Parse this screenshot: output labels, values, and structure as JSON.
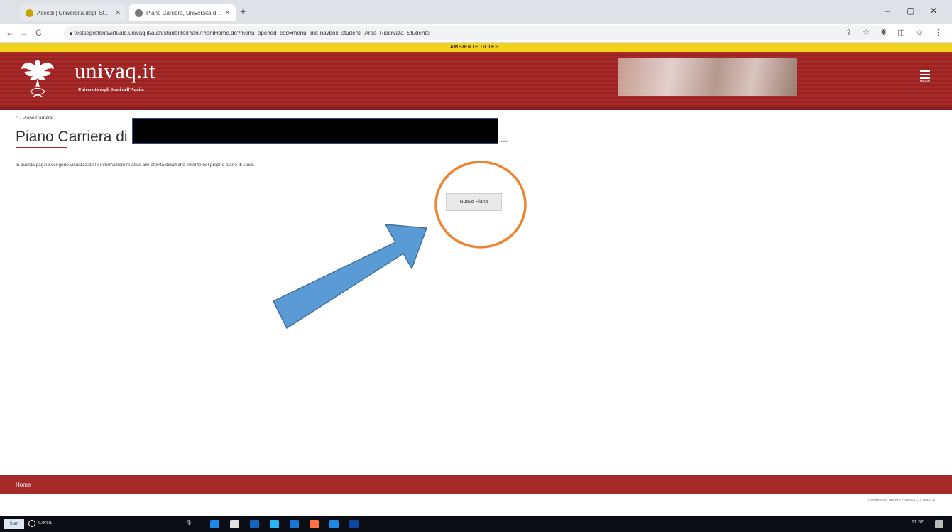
{
  "browser": {
    "tabs": [
      {
        "title": "Accedi | Università degli Studi de...",
        "active": false
      },
      {
        "title": "Piano Carriera, Università di Ul...",
        "active": true
      }
    ],
    "new_tab": "+",
    "window_controls": {
      "minimize": "–",
      "maximize": "▢",
      "close": "✕"
    },
    "nav": {
      "back": "←",
      "forward": "→",
      "reload": "C"
    },
    "url": "testsegreteriavirtuale.univaq.it/auth/studente/Piani/PianiHome.do?menu_opened_cod=menu_link-navbox_studenti_Area_Riservata_Studente",
    "toolbar_icons": "⇪ ☆ ✱ ◫ ☺ ⋮"
  },
  "site": {
    "test_banner": "AMBIENTE DI TEST",
    "logo_text": "univaq.it",
    "logo_subtitle": "Università degli Studi dell'Aquila",
    "menu_label": "MENU",
    "colors": {
      "primary": "#a72a2a",
      "banner": "#f3d21c"
    }
  },
  "main": {
    "breadcrumb_home_icon": "home-icon",
    "breadcrumb_home": "⌂",
    "breadcrumb_current": "/ Piano Carriera",
    "title": "Piano Carriera di",
    "title_tail": "...",
    "description": "In questa pagina vengono visualizzate le informazioni relative alle attività didattiche inserite nel proprio piano di studi.",
    "new_plan_button": "Nuovo Piano"
  },
  "footer": {
    "home_link": "Home",
    "note": "Informativa utilizzo cookie | © CINECA"
  },
  "taskbar": {
    "start": "Start",
    "search": "Cerca",
    "mic": "🎙",
    "clock": "11:52"
  }
}
